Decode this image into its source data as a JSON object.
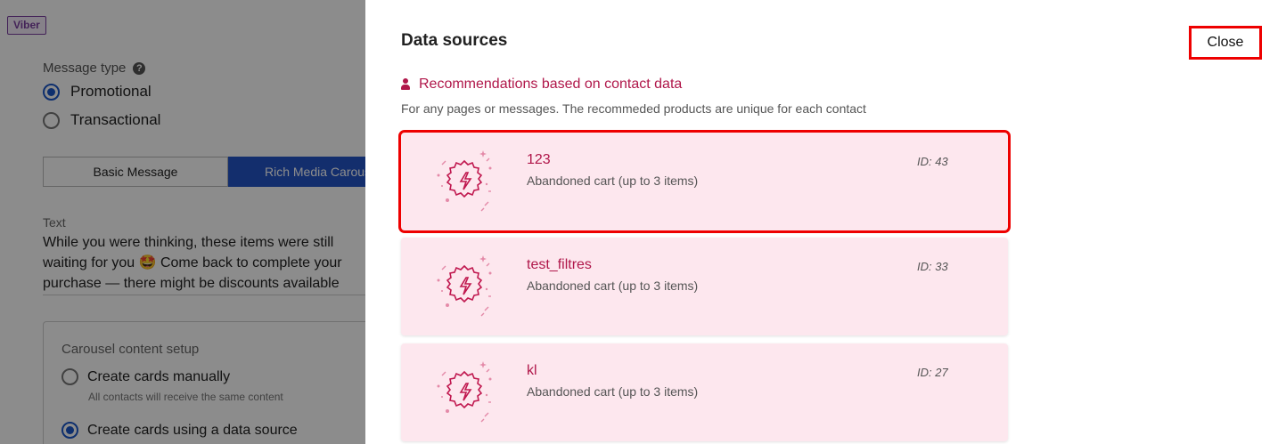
{
  "background": {
    "badge": "Viber",
    "message_type_label": "Message type",
    "message_types": [
      {
        "label": "Promotional",
        "checked": true
      },
      {
        "label": "Transactional",
        "checked": false
      }
    ],
    "tabs": [
      "Basic Message",
      "Rich Media Carous"
    ],
    "text_label": "Text",
    "text_value": "While you were thinking, these items were still waiting for you 🤩 Come back to complete your purchase — there might be discounts available",
    "carousel_title": "Carousel content setup",
    "carousel_options": [
      {
        "label": "Create cards manually",
        "sub": "All contacts will receive the same content",
        "checked": false
      },
      {
        "label": "Create cards using a data source",
        "sub": "",
        "checked": true
      }
    ]
  },
  "panel": {
    "title": "Data sources",
    "close_label": "Close",
    "section_title": "Recommendations based on contact data",
    "section_desc": "For any pages or messages. The recommeded products are unique for each contact",
    "cards": [
      {
        "name": "123",
        "type": "Abandoned cart (up to 3 items)",
        "id": "ID: 43"
      },
      {
        "name": "test_filtres",
        "type": "Abandoned cart (up to 3 items)",
        "id": "ID: 33"
      },
      {
        "name": "kl",
        "type": "Abandoned cart (up to 3 items)",
        "id": "ID: 27"
      }
    ]
  },
  "colors": {
    "accent": "#b0174a",
    "card_bg": "#fde7ee",
    "highlight": "#ee0000",
    "primary_blue": "#2454c6"
  }
}
